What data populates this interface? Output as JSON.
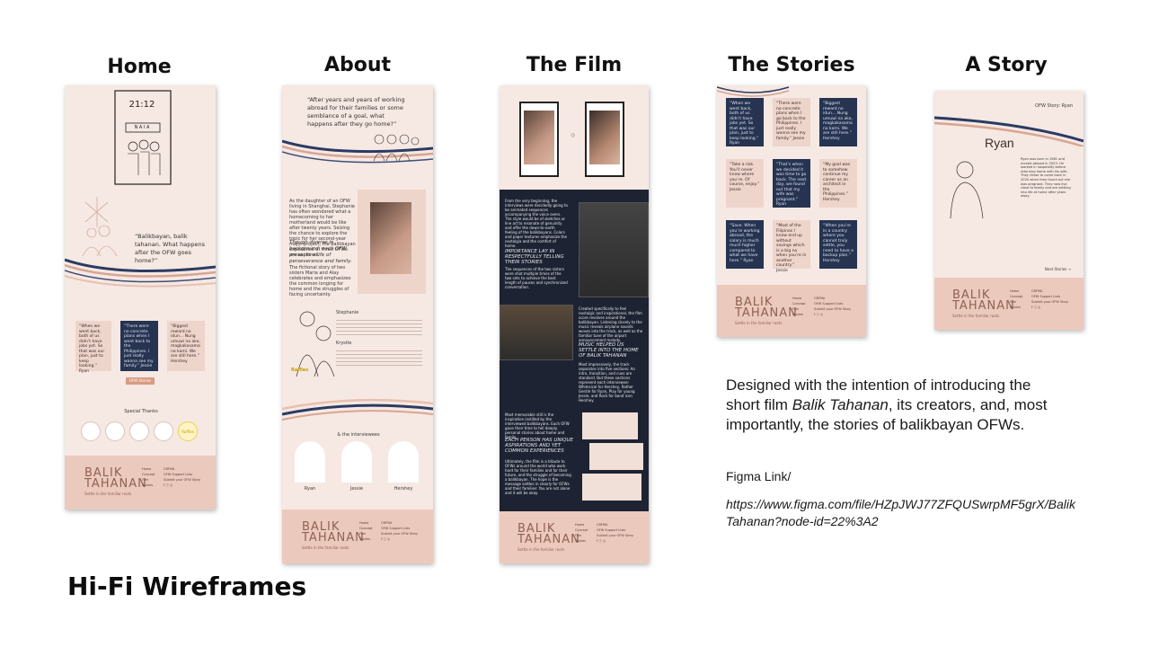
{
  "columns": {
    "home": "Home",
    "about": "About",
    "film": "The Film",
    "stories": "The Stories",
    "story": "A Story"
  },
  "home": {
    "clock": "21:12",
    "sign": "N A I A",
    "quote": "“Balikbayan, balik tahanan. What happens after the OFW goes home?”",
    "cards": [
      "“When we went back, both of us didn’t have jobs yet. So that was our plan, just to keep looking.” Ryan",
      "“There were no concrete plans when I went back to the Philippines. I just really wanna see my family.” Jessie",
      "“Biggest reward no idun… Nung umuwi na ako, magkakasama na kami. We are still here.” Hershey"
    ],
    "button": "OFW Stories",
    "thanks": "Special Thanks",
    "raffles": "Raffles"
  },
  "about": {
    "quote": "“After years and years of working abroad for their families or some semblance of a goal, what happens after they go home?”",
    "intro": "As the daughter of an OFW living in Shanghai, Stephanie has often wondered what a homecoming to her motherland would be like after twenty years. Seizing the chance to explore the topic for her second-year major project, the balikbayan experience of three OFWs are explored.",
    "highlight": "Though diverse in background, each OFW presents a life of perseverance and family.",
    "body": "The fictional story of two sisters Maria and Alay celebrates and emphasizes the common longing for home and the struggles of facing uncertainty.",
    "name1": "Stephanie",
    "name2": "Krystle",
    "interviewees_label": "& the interviewees",
    "interviewees": [
      "Ryan",
      "Jessie",
      "Hershey"
    ],
    "raffles": "Raffles"
  },
  "film": {
    "p1": "From the very beginning, the interviews were decidedly going to be animated sequences accompanying the voice overs. The style would be of sketches or line art to resonate of genuinity and offer the down-to-earth feeling of the balikbayans. Colors and paper textures emphasize the nostalgia and the comfort of home.",
    "h1": "IMPORTANCE LAY IN RESPECTFULLY TELLING THEIR STORIES",
    "p2": "The sequences of the two sisters were shot multiple times of the two sets to achieve the best length of pauses and synchronized conversation.",
    "p3": "Created specifically to feel nostalgic and inspirational, the film score revolves around the balikbayan. Listening closely to the music reveals airplane sounds woven into the track, as well as the familiar tune of the airport announcement melody.",
    "h2": "MUSIC HELPED US SETTLE INTO THE HOME OF BALIK TAHANAN",
    "p4": "Most impressively, the track separates into five sections: An intro, transition, and cues are standard. But these sections represent each interviewee: Whimsical for Hershey, Rather Gentle for Ryan, Play for young Jessie, and Rock for band icon Hershey.",
    "p5": "Most memorable still is the inspiration instilled by the interviewed balikbayans. Each OFW gave their time to tell deeply personal stories about home and family.",
    "h3": "EACH PERSON HAS UNIQUE ASPIRATIONS AND YET COMMON EXPERIENCES",
    "p6": "Ultimately, the film is a tribute to OFWs around the world who work hard for their families and for their future, and the struggle of becoming a balikbayan. The hope is the message settles in clearly for OFWs and their families: You are not alone and it will be okay."
  },
  "stories": {
    "cards": [
      "“When we went back, both of us didn’t have jobs yet. So that was our plan, just to keep looking.” Ryan",
      "“There were no concrete plans when I go back to the Philippines. I just really wanna see my family.” Jessie",
      "“Biggest reward no idun… Nung umuwi na ako, magkakasama na kami. We are still here.” Hershey",
      "“Take a risk. You’ll never know where you’re. Of course, enjoy.” Jessie",
      "“That’s when we decided it was time to go back. The next day, we found out that my wife was pregnant.” Ryan",
      "“My goal was to somehow continue my career as an architect in the Philippines.” Hershey",
      "“Save. When you’re working abroad, the salary is much much higher compared to what we have here.” Ryan",
      "“Most of the Filipinos I know end up without savings which is a big no when you’re in another country.” Jessie",
      "“When you’re in a country where you cannot truly settle, you need to have a backup plan.” Hershey"
    ]
  },
  "story": {
    "header": "OFW Story: Ryan",
    "name": "Ryan",
    "body": "Ryan was born in 1981 and moved abroad in 2003. He worked in hospitality before returning home with his wife. They chose to come back in 2020 when they found out she was pregnant. They now live close to family and are settling into life at home after years away.",
    "next": "Next Stories →"
  },
  "footer": {
    "logo_line1": "BALIK",
    "logo_line2": "TAHANAN",
    "tagline": "Settle in the familiar roots",
    "labels": [
      "Home",
      "Concept",
      "Film",
      "Stories"
    ],
    "values": [
      "CBFMA",
      "OFW Support Lists",
      "Submit your OFW Story",
      "f  ⓘ  ◎"
    ]
  },
  "description": {
    "part1": "Designed with the intention of introducing the short film ",
    "film_title": "Balik Tahanan",
    "part2": ", its creators, and, most importantly, the stories of balikbayan OFWs."
  },
  "figma": {
    "label": "Figma Link/",
    "url": "https://www.figma.com/file/HZpJWJ77ZFQUSwrpMF5grX/BalikTahanan?node-id=22%3A2"
  },
  "title": "Hi-Fi Wireframes",
  "colors": {
    "frame_bg": "#f6e8e2",
    "navy": "#263452",
    "peach": "#ecc9bd",
    "dark": "#1d2332"
  }
}
